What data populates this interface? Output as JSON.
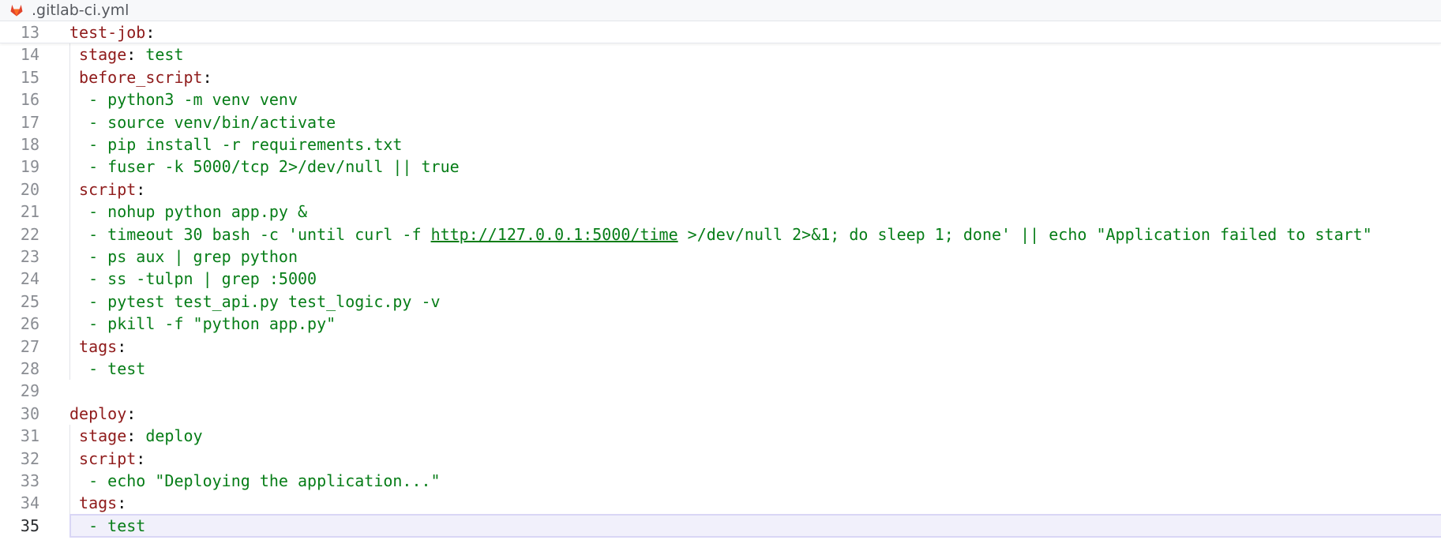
{
  "tab": {
    "icon": "gitlab-icon",
    "filename": ".gitlab-ci.yml",
    "icon_color": "#e2432a"
  },
  "editor": {
    "current_line": 35,
    "colors": {
      "key": "#8f1b1b",
      "string": "#067d17",
      "gutter": "#8a8d93",
      "current_line_bg": "#f1f0fb"
    },
    "lines": [
      {
        "num": "13",
        "tokens": [
          {
            "t": "test-job",
            "c": "key root"
          },
          {
            "t": ":",
            "c": "colon"
          }
        ]
      },
      {
        "num": "14",
        "tokens": [
          {
            "t": " stage",
            "c": "key sub"
          },
          {
            "t": ": ",
            "c": "colon"
          },
          {
            "t": "test",
            "c": "str"
          }
        ]
      },
      {
        "num": "15",
        "tokens": [
          {
            "t": " before_script",
            "c": "key sub"
          },
          {
            "t": ":",
            "c": "colon"
          }
        ]
      },
      {
        "num": "16",
        "tokens": [
          {
            "t": "  - python3 -m venv venv",
            "c": "str"
          }
        ]
      },
      {
        "num": "17",
        "tokens": [
          {
            "t": "  - source venv/bin/activate",
            "c": "str"
          }
        ]
      },
      {
        "num": "18",
        "tokens": [
          {
            "t": "  - pip install -r requirements.txt",
            "c": "str"
          }
        ]
      },
      {
        "num": "19",
        "tokens": [
          {
            "t": "  - fuser -k 5000/tcp 2>/dev/null || true",
            "c": "str"
          }
        ]
      },
      {
        "num": "20",
        "tokens": [
          {
            "t": " script",
            "c": "key sub"
          },
          {
            "t": ":",
            "c": "colon"
          }
        ]
      },
      {
        "num": "21",
        "tokens": [
          {
            "t": "  - nohup python app.py &",
            "c": "str"
          }
        ]
      },
      {
        "num": "22",
        "tokens": [
          {
            "t": "  - timeout 30 bash -c 'until curl -f ",
            "c": "str"
          },
          {
            "t": "http://127.0.0.1:5000/time",
            "c": "str url"
          },
          {
            "t": " >/dev/null 2>&1; do sleep 1; done' || echo \"Application failed to start\"",
            "c": "str"
          }
        ]
      },
      {
        "num": "23",
        "tokens": [
          {
            "t": "  - ps aux | grep python",
            "c": "str"
          }
        ]
      },
      {
        "num": "24",
        "tokens": [
          {
            "t": "  - ss -tulpn | grep :5000",
            "c": "str"
          }
        ]
      },
      {
        "num": "25",
        "tokens": [
          {
            "t": "  - pytest test_api.py test_logic.py -v",
            "c": "str"
          }
        ]
      },
      {
        "num": "26",
        "tokens": [
          {
            "t": "  - pkill -f \"python app.py\"",
            "c": "str"
          }
        ]
      },
      {
        "num": "27",
        "tokens": [
          {
            "t": " tags",
            "c": "key sub"
          },
          {
            "t": ":",
            "c": "colon"
          }
        ]
      },
      {
        "num": "28",
        "tokens": [
          {
            "t": "  - test",
            "c": "str"
          }
        ]
      },
      {
        "num": "29",
        "tokens": []
      },
      {
        "num": "30",
        "tokens": [
          {
            "t": "deploy",
            "c": "key root"
          },
          {
            "t": ":",
            "c": "colon"
          }
        ]
      },
      {
        "num": "31",
        "tokens": [
          {
            "t": " stage",
            "c": "key sub"
          },
          {
            "t": ": ",
            "c": "colon"
          },
          {
            "t": "deploy",
            "c": "str"
          }
        ]
      },
      {
        "num": "32",
        "tokens": [
          {
            "t": " script",
            "c": "key sub"
          },
          {
            "t": ":",
            "c": "colon"
          }
        ]
      },
      {
        "num": "33",
        "tokens": [
          {
            "t": "  - echo \"Deploying the application...\"",
            "c": "str"
          }
        ]
      },
      {
        "num": "34",
        "tokens": [
          {
            "t": " tags",
            "c": "key sub"
          },
          {
            "t": ":",
            "c": "colon"
          }
        ]
      },
      {
        "num": "35",
        "tokens": [
          {
            "t": "  - test",
            "c": "str"
          }
        ]
      }
    ]
  }
}
